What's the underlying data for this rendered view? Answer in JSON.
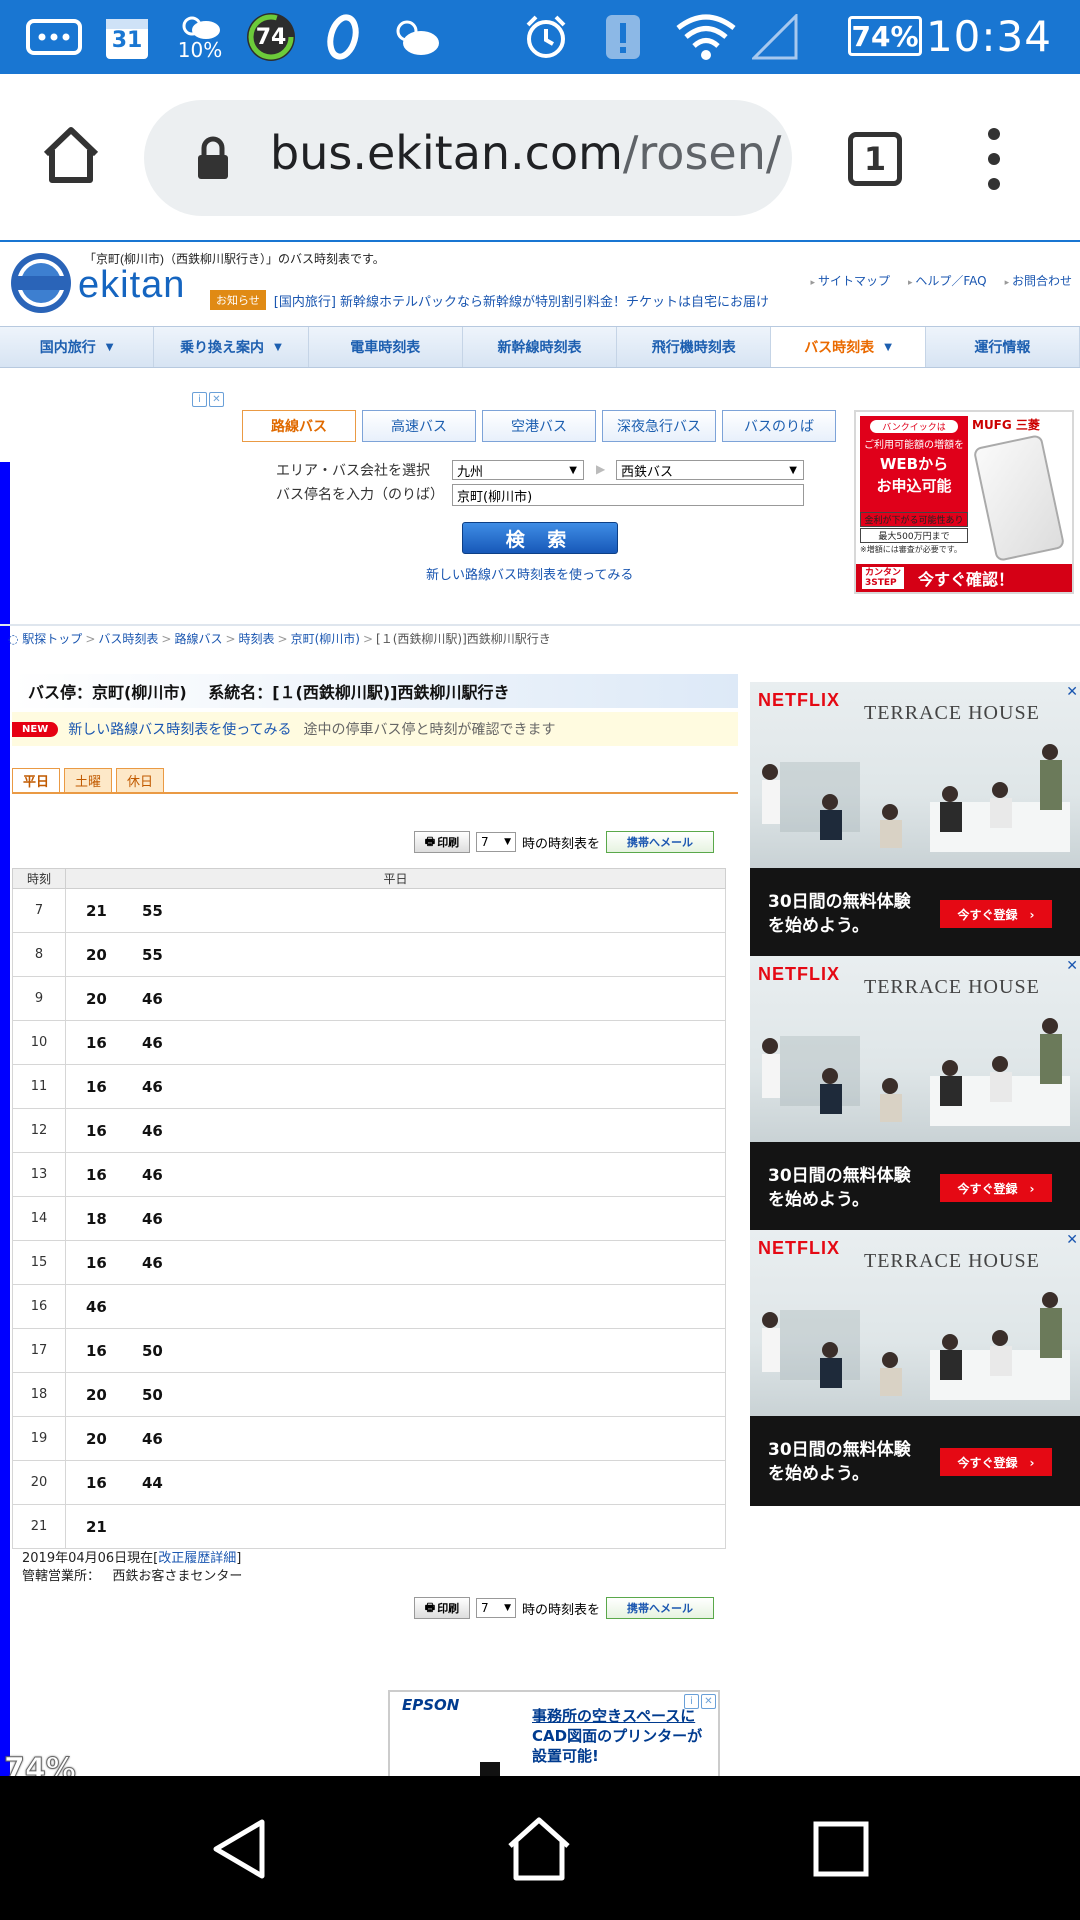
{
  "status_bar": {
    "calendar_day": "31",
    "weather_temp": "10%",
    "badge_74": "74",
    "battery": "74%",
    "clock": "10:34",
    "icons": [
      "chat-icon",
      "calendar-icon",
      "weather-icon",
      "speed-badge-icon",
      "opera-icon",
      "cloud-sun-icon",
      "alarm-icon",
      "alert-icon",
      "wifi-icon",
      "signal-icon",
      "battery-icon"
    ]
  },
  "browser": {
    "url_host": "bus.ekitan.com",
    "url_path": "/rosen/",
    "tab_count": "1"
  },
  "site": {
    "logo_text": "ekitan",
    "intro": "「京町(柳川市)（西鉄柳川駅行き）」のバス時刻表です。",
    "header_links": [
      "サイトマップ",
      "ヘルプ／FAQ",
      "お問合わせ"
    ],
    "notice_badge": "お知らせ",
    "notice_text": "[国内旅行] 新幹線ホテルパックなら新幹線が特別割引料金！チケットは自宅にお届け",
    "nav": [
      {
        "label": "国内旅行",
        "caret": "▼"
      },
      {
        "label": "乗り換え案内",
        "caret": "▼"
      },
      {
        "label": "電車時刻表",
        "caret": ""
      },
      {
        "label": "新幹線時刻表",
        "caret": ""
      },
      {
        "label": "飛行機時刻表",
        "caret": ""
      },
      {
        "label": "バス時刻表",
        "caret": "▼"
      },
      {
        "label": "運行情報",
        "caret": ""
      }
    ],
    "active_nav": "バス時刻表"
  },
  "search": {
    "tabs": [
      "路線バス",
      "高速バス",
      "空港バス",
      "深夜急行バス",
      "バスのりば"
    ],
    "active_tab": "路線バス",
    "area_label": "エリア・バス会社を選択",
    "area_value": "九州",
    "company_value": "西鉄バス",
    "stop_label": "バス停名を入力（のりば）",
    "stop_value": "京町(柳川市)",
    "button": "検 索",
    "new_link": "新しい路線バス時刻表を使ってみる"
  },
  "mufg_ad": {
    "brand": "MUFG 三菱",
    "pill": "バンクイックは",
    "line1": "ご利用可能額の増額を",
    "big1": "WEBから",
    "big2": "お申込可能",
    "note1": "金利が下がる可能性あり",
    "note2": "最大500万円まで",
    "note3": "※増額には審査が必要です。",
    "step1": "カンタン",
    "step2": "3STEP",
    "cta": "今すぐ確認！"
  },
  "breadcrumb": [
    "駅探トップ",
    "バス時刻表",
    "路線バス",
    "時刻表",
    "京町(柳川市)",
    "[１(西鉄柳川駅)]西鉄柳川駅行き"
  ],
  "stop": {
    "header": "バス停：京町(柳川市)　 系統名：[１(西鉄柳川駅)]西鉄柳川駅行き",
    "new_badge": "NEW",
    "new_link": "新しい路線バス時刻表を使ってみる",
    "new_desc": "途中の停車バス停と時刻が確認できます"
  },
  "day_tabs": [
    "平日",
    "土曜",
    "休日"
  ],
  "active_day": "平日",
  "print_row": {
    "print": "印刷",
    "hour": "7",
    "hour_suffix": "時の時刻表を",
    "mail": "携帯へメール"
  },
  "timetable": {
    "col_hour": "時刻",
    "col_day": "平日",
    "rows": [
      {
        "hour": "7",
        "minutes": [
          "21",
          "55"
        ]
      },
      {
        "hour": "8",
        "minutes": [
          "20",
          "55"
        ]
      },
      {
        "hour": "9",
        "minutes": [
          "20",
          "46"
        ]
      },
      {
        "hour": "10",
        "minutes": [
          "16",
          "46"
        ]
      },
      {
        "hour": "11",
        "minutes": [
          "16",
          "46"
        ]
      },
      {
        "hour": "12",
        "minutes": [
          "16",
          "46"
        ]
      },
      {
        "hour": "13",
        "minutes": [
          "16",
          "46"
        ]
      },
      {
        "hour": "14",
        "minutes": [
          "18",
          "46"
        ]
      },
      {
        "hour": "15",
        "minutes": [
          "16",
          "46"
        ]
      },
      {
        "hour": "16",
        "minutes": [
          "46"
        ]
      },
      {
        "hour": "17",
        "minutes": [
          "16",
          "50"
        ]
      },
      {
        "hour": "18",
        "minutes": [
          "20",
          "50"
        ]
      },
      {
        "hour": "19",
        "minutes": [
          "20",
          "46"
        ]
      },
      {
        "hour": "20",
        "minutes": [
          "16",
          "44"
        ]
      },
      {
        "hour": "21",
        "minutes": [
          "21"
        ]
      }
    ]
  },
  "footer_info": {
    "date": "2019年04月06日現在",
    "history_link": "改正履歴詳細",
    "office_label": "管轄営業所：",
    "office": "西鉄お客さまセンター"
  },
  "netflix_ad": {
    "brand": "NETFLIX",
    "title": "TERRACE HOUSE",
    "copy1": "30日間の無料体験",
    "copy2": "を始めよう。",
    "cta": "今すぐ登録　›"
  },
  "epson_ad": {
    "brand": "EPSON",
    "line1": "事務所の空きスペースに",
    "line2": "CAD図面のプリンターが",
    "line3": "設置可能!"
  },
  "zoom_overlay": "74%"
}
